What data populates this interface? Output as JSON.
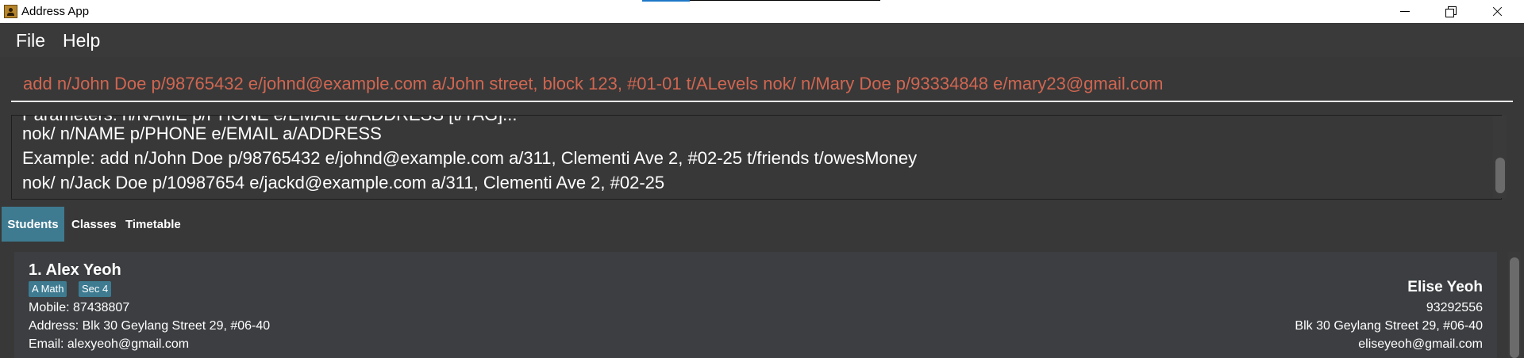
{
  "window": {
    "title": "Address App"
  },
  "menu": {
    "file": "File",
    "help": "Help"
  },
  "command": {
    "value": "add n/John Doe p/98765432 e/johnd@example.com a/John street, block 123, #01-01 t/ALevels nok/ n/Mary Doe p/93334848 e/mary23@gmail.com"
  },
  "result": {
    "lines": [
      "Parameters: n/NAME p/PHONE e/EMAIL a/ADDRESS [t/TAG]...",
      "nok/ n/NAME p/PHONE e/EMAIL a/ADDRESS",
      "Example: add n/John Doe p/98765432 e/johnd@example.com a/311, Clementi Ave 2, #02-25 t/friends t/owesMoney",
      "nok/ n/Jack Doe p/10987654 e/jackd@example.com a/311, Clementi Ave 2, #02-25"
    ]
  },
  "tabs": [
    {
      "label": "Students",
      "selected": true
    },
    {
      "label": "Classes",
      "selected": false
    },
    {
      "label": "Timetable",
      "selected": false
    }
  ],
  "students": [
    {
      "index_name": "1.  Alex Yeoh",
      "tags": [
        "A Math",
        "Sec 4"
      ],
      "mobile": "Mobile: 87438807",
      "address": "Address: Blk 30 Geylang Street 29, #06-40",
      "email": "Email: alexyeoh@gmail.com",
      "nok": {
        "name": "Elise Yeoh",
        "phone": "93292556",
        "address": "Blk 30 Geylang Street 29, #06-40",
        "email": "eliseyeoh@gmail.com"
      }
    }
  ],
  "colors": {
    "accent": "#3e7b91",
    "command_text": "#d06651",
    "background": "#383838"
  }
}
